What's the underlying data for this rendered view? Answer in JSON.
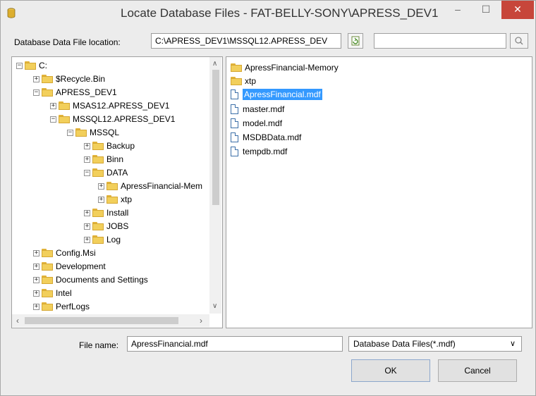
{
  "window": {
    "title": "Locate Database Files - FAT-BELLY-SONY\\APRESS_DEV1",
    "minimize": "–",
    "maximize": "☐",
    "close": "✕"
  },
  "location": {
    "label": "Database Data File location:",
    "path": "C:\\APRESS_DEV1\\MSSQL12.APRESS_DEV",
    "search_value": ""
  },
  "tree": [
    {
      "label": "C:",
      "expander": "−"
    },
    {
      "label": "$Recycle.Bin",
      "expander": "+"
    },
    {
      "label": "APRESS_DEV1",
      "expander": "−"
    },
    {
      "label": "MSAS12.APRESS_DEV1",
      "expander": "+"
    },
    {
      "label": "MSSQL12.APRESS_DEV1",
      "expander": "−"
    },
    {
      "label": "MSSQL",
      "expander": "−"
    },
    {
      "label": "Backup",
      "expander": "+"
    },
    {
      "label": "Binn",
      "expander": "+"
    },
    {
      "label": "DATA",
      "expander": "−"
    },
    {
      "label": "ApressFinancial-Mem",
      "expander": "+"
    },
    {
      "label": "xtp",
      "expander": "+"
    },
    {
      "label": "Install",
      "expander": "+"
    },
    {
      "label": "JOBS",
      "expander": "+"
    },
    {
      "label": "Log",
      "expander": "+"
    },
    {
      "label": "Config.Msi",
      "expander": "+"
    },
    {
      "label": "Development",
      "expander": "+"
    },
    {
      "label": "Documents and Settings",
      "expander": "+"
    },
    {
      "label": "Intel",
      "expander": "+"
    },
    {
      "label": "PerfLogs",
      "expander": "+"
    }
  ],
  "files": [
    {
      "label": "ApressFinancial-Memory",
      "kind": "folder-icon"
    },
    {
      "label": "xtp",
      "kind": "folder-icon"
    },
    {
      "label": "ApressFinancial.mdf",
      "kind": "file-icon",
      "selected": true
    },
    {
      "label": "master.mdf",
      "kind": "file-icon"
    },
    {
      "label": "model.mdf",
      "kind": "file-icon"
    },
    {
      "label": "MSDBData.mdf",
      "kind": "file-icon"
    },
    {
      "label": "tempdb.mdf",
      "kind": "file-icon"
    }
  ],
  "bottom": {
    "file_name_label": "File name:",
    "file_name_value": "ApressFinancial.mdf",
    "filter_value": "Database Data Files(*.mdf)",
    "ok_label": "OK",
    "cancel_label": "Cancel"
  },
  "colors": {
    "selection": "#3399ff",
    "close_button": "#c7463a",
    "folder": "#f2cf5b"
  }
}
